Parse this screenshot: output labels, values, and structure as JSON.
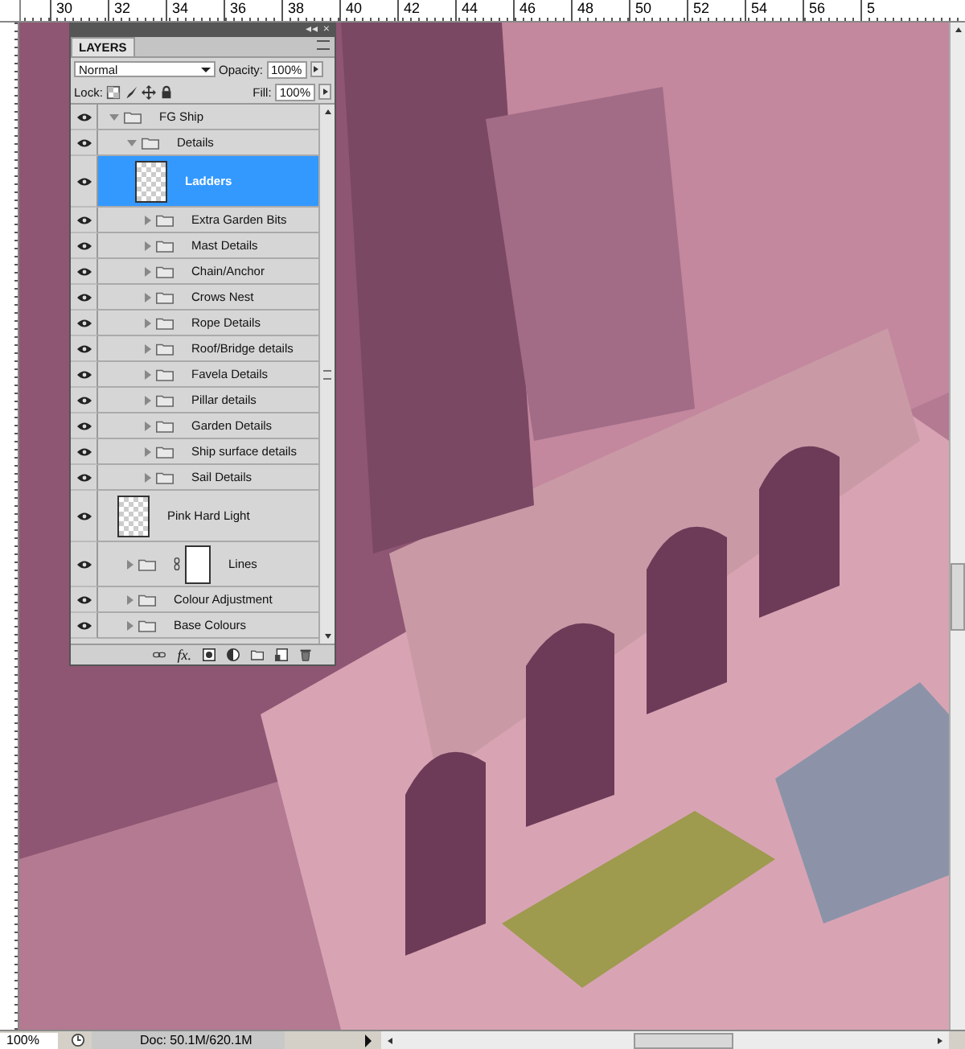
{
  "rulers": {
    "top_labels": [
      "30",
      "32",
      "34",
      "36",
      "38",
      "40",
      "42",
      "44",
      "46",
      "48",
      "50",
      "52",
      "54",
      "56",
      "5"
    ]
  },
  "layers_panel": {
    "collapse_button": "◂◂",
    "close_button": "×",
    "tab": "LAYERS",
    "blend_mode": "Normal",
    "opacity_label": "Opacity:",
    "opacity": "100%",
    "lock_label": "Lock:",
    "fill_label": "Fill:",
    "fill": "100%",
    "effects_button": "fx.",
    "items": [
      {
        "name": "FG Ship",
        "kind": "group",
        "visible": true,
        "expanded": true,
        "selected": false,
        "children": [
          {
            "name": "Details",
            "kind": "group",
            "visible": true,
            "expanded": true,
            "selected": false,
            "children": [
              {
                "name": "Ladders",
                "kind": "layer",
                "visible": true,
                "selected": true
              },
              {
                "name": "Extra Garden Bits",
                "kind": "group",
                "visible": true,
                "expanded": false,
                "selected": false
              },
              {
                "name": "Mast Details",
                "kind": "group",
                "visible": true,
                "expanded": false,
                "selected": false
              },
              {
                "name": "Chain/Anchor",
                "kind": "group",
                "visible": true,
                "expanded": false,
                "selected": false
              },
              {
                "name": "Crows Nest",
                "kind": "group",
                "visible": true,
                "expanded": false,
                "selected": false
              },
              {
                "name": "Rope Details",
                "kind": "group",
                "visible": true,
                "expanded": false,
                "selected": false
              },
              {
                "name": "Roof/Bridge details",
                "kind": "group",
                "visible": true,
                "expanded": false,
                "selected": false
              },
              {
                "name": "Favela Details",
                "kind": "group",
                "visible": true,
                "expanded": false,
                "selected": false
              },
              {
                "name": "Pillar details",
                "kind": "group",
                "visible": true,
                "expanded": false,
                "selected": false
              },
              {
                "name": "Garden Details",
                "kind": "group",
                "visible": true,
                "expanded": false,
                "selected": false
              },
              {
                "name": "Ship surface details",
                "kind": "group",
                "visible": true,
                "expanded": false,
                "selected": false
              },
              {
                "name": "Sail Details",
                "kind": "group",
                "visible": true,
                "expanded": false,
                "selected": false
              }
            ]
          },
          {
            "name": "Pink Hard Light",
            "kind": "layer",
            "visible": true,
            "selected": false
          },
          {
            "name": "Lines",
            "kind": "group",
            "visible": true,
            "expanded": false,
            "selected": false,
            "mask": true
          },
          {
            "name": "Colour Adjustment",
            "kind": "group",
            "visible": true,
            "expanded": false,
            "selected": false
          },
          {
            "name": "Base Colours",
            "kind": "group",
            "visible": true,
            "expanded": false,
            "selected": false
          }
        ]
      }
    ]
  },
  "status_bar": {
    "zoom": "100%",
    "doc_info": "Doc: 50.1M/620.1M"
  }
}
